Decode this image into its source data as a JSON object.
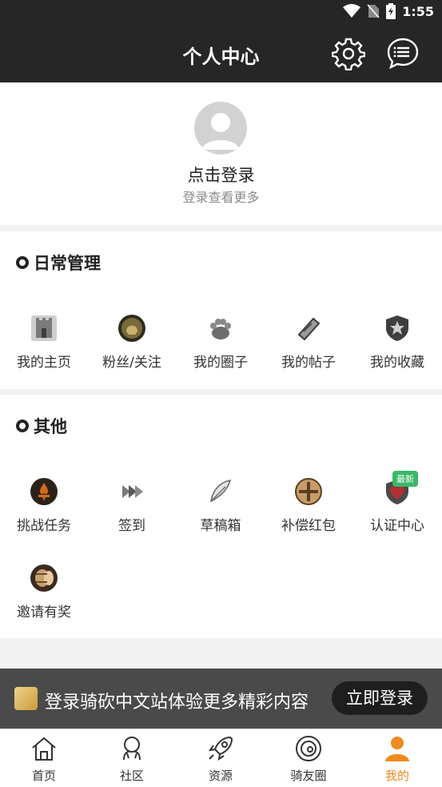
{
  "status_bar": {
    "time": "1:55"
  },
  "header": {
    "title": "个人中心"
  },
  "profile": {
    "login_text": "点击登录",
    "login_sub": "登录查看更多"
  },
  "daily": {
    "title": "日常管理",
    "items": [
      {
        "label": "我的主页",
        "icon": "castle-icon"
      },
      {
        "label": "粉丝/关注",
        "icon": "helmet-coin-icon"
      },
      {
        "label": "我的圈子",
        "icon": "paw-icon"
      },
      {
        "label": "我的帖子",
        "icon": "scroll-icon"
      },
      {
        "label": "我的收藏",
        "icon": "star-shield-icon"
      }
    ]
  },
  "other": {
    "title": "其他",
    "items": [
      {
        "label": "挑战任务",
        "icon": "fleur-coin-icon"
      },
      {
        "label": "签到",
        "icon": "arrows-icon"
      },
      {
        "label": "草稿箱",
        "icon": "feather-icon"
      },
      {
        "label": "补偿红包",
        "icon": "cross-shield-icon"
      },
      {
        "label": "认证中心",
        "icon": "heart-shield-icon",
        "badge": "最新"
      },
      {
        "label": "邀请有奖",
        "icon": "barrel-icon"
      }
    ]
  },
  "banner": {
    "text": "登录骑砍中文站体验更多精彩内容",
    "button": "立即登录"
  },
  "tabs": [
    {
      "label": "首页",
      "icon": "home-icon"
    },
    {
      "label": "社区",
      "icon": "community-icon"
    },
    {
      "label": "资源",
      "icon": "rocket-icon"
    },
    {
      "label": "骑友圈",
      "icon": "circle-icon"
    },
    {
      "label": "我的",
      "icon": "person-icon",
      "active": true
    }
  ],
  "colors": {
    "accent": "#f08a1e",
    "header_bg": "#262626"
  }
}
